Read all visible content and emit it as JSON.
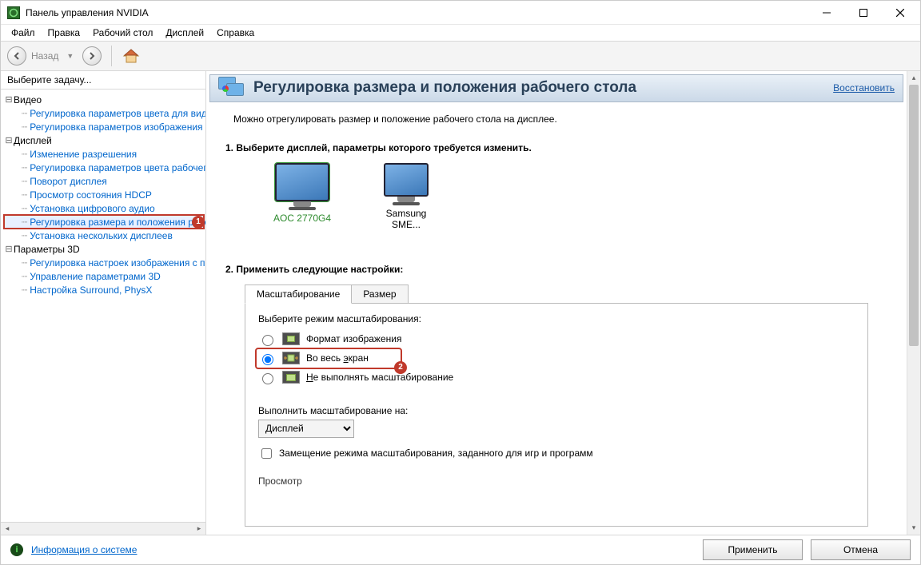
{
  "window": {
    "title": "Панель управления NVIDIA"
  },
  "menu": {
    "file": "Файл",
    "edit": "Правка",
    "desktop": "Рабочий стол",
    "display": "Дисплей",
    "help": "Справка"
  },
  "nav": {
    "back_label": "Назад"
  },
  "sidebar": {
    "header": "Выберите задачу...",
    "video": {
      "label": "Видео",
      "items": [
        "Регулировка параметров цвета для вид",
        "Регулировка параметров изображения д"
      ]
    },
    "display": {
      "label": "Дисплей",
      "items": [
        "Изменение разрешения",
        "Регулировка параметров цвета рабочег",
        "Поворот дисплея",
        "Просмотр состояния HDCP",
        "Установка цифрового аудио",
        "Регулировка размера и положения рабо",
        "Установка нескольких дисплеев"
      ],
      "selected_index": 5,
      "badge": "1"
    },
    "params3d": {
      "label": "Параметры 3D",
      "items": [
        "Регулировка настроек изображения с пр",
        "Управление параметрами 3D",
        "Настройка Surround, PhysX"
      ]
    }
  },
  "page": {
    "title": "Регулировка размера и положения рабочего стола",
    "restore": "Восстановить",
    "subtitle": "Можно отрегулировать размер и положение рабочего стола на дисплее.",
    "step1_title": "1. Выберите дисплей, параметры которого требуется изменить.",
    "displays": [
      {
        "name": "AOC 2770G4",
        "selected": true
      },
      {
        "name": "Samsung SME...",
        "selected": false
      }
    ],
    "step2_title": "2. Применить следующие настройки:",
    "tabs": {
      "scaling": "Масштабирование",
      "size": "Размер"
    },
    "scaling": {
      "mode_label": "Выберите режим масштабирования:",
      "opt_aspect": "Формат изображения",
      "opt_full_pre": "Во весь ",
      "opt_full_u": "э",
      "opt_full_post": "кран",
      "opt_none_pre": "",
      "opt_none_u": "Н",
      "opt_none_post": "е выполнять масштабирование",
      "selected": "full",
      "badge": "2",
      "perform_on_label": "Выполнить масштабирование на:",
      "perform_on_value": "Дисплей",
      "override_label": "Замещение режима масштабирования, заданного для игр и программ",
      "override_checked": false,
      "preview_label": "Просмотр"
    }
  },
  "footer": {
    "sysinfo": "Информация о системе",
    "apply": "Применить",
    "cancel": "Отмена"
  }
}
